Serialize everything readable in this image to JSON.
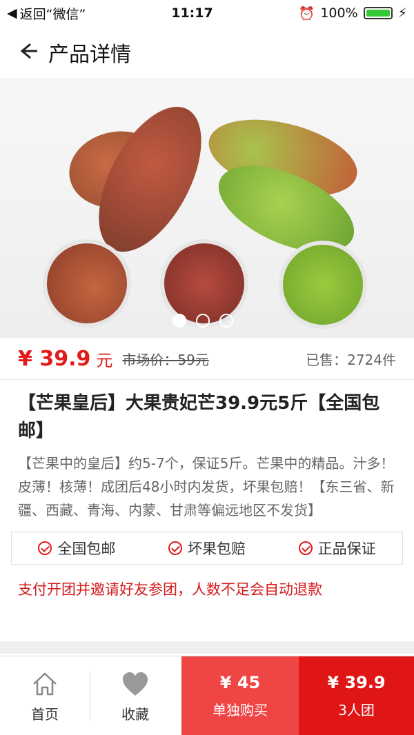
{
  "status_bar": {
    "back_label": "返回“微信”",
    "time": "11:17",
    "battery": "100%"
  },
  "navbar": {
    "title": "产品详情"
  },
  "product": {
    "price": "¥ 39.9",
    "unit": "元",
    "market_price": "市场价：59元",
    "sold": "已售：2724件",
    "title": "【芒果皇后】大果贵妃芒39.9元5斤【全国包邮】",
    "description": "【芒果中的皇后】约5-7个，保证5斤。芒果中的精品。汁多！皮薄！核薄！成团后48小时内发货，坏果包赔！【东三省、新疆、西藏、青海、内蒙、甘肃等偏远地区不发货】"
  },
  "carousel": {
    "active_index": 0,
    "total": 3
  },
  "guarantees": [
    "全国包邮",
    "坏果包赔",
    "正品保证"
  ],
  "notice": "支付开团并邀请好友参团，人数不足会自动退款",
  "tabbar": {
    "home_label": "首页",
    "favorite_label": "收藏",
    "solo": {
      "price": "¥ 45",
      "label": "单独购买"
    },
    "group": {
      "price": "¥ 39.9",
      "label": "3人团"
    }
  },
  "colors": {
    "accent": "#e31a1a",
    "solo_bg": "#f04545",
    "group_bg": "#e01515"
  }
}
